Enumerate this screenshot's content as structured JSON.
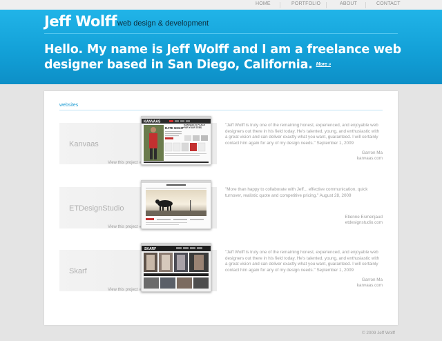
{
  "nav": {
    "items": [
      "HOME",
      "PORTFOLIO",
      "ABOUT",
      "CONTACT"
    ]
  },
  "header": {
    "logo": "Jeff Wolff",
    "tagline": "web design & development",
    "headline": "Hello. My name is Jeff Wolff and I am a freelance web designer based in San Diego, California.",
    "more": "More »"
  },
  "section": {
    "title": "websites"
  },
  "projects": [
    {
      "name": "Kanvaas",
      "link": "View this project »",
      "quote": "\"Jeff Wolff is truly one of the remaining honest, experienced, and enjoyable web designers out there in his field today. He's talented, young, and enthusiastic with a great vision and can deliver exactly what you want, guaranteed. I will certainly contact him again for any of my design needs.\" September 1, 2009",
      "author": "Garron Ma",
      "site": "kanvaas.com",
      "thumb": {
        "brand": "KANVAAS",
        "banner": "DATE NIGHT",
        "side": "KANVAAS IS PLACE FOR YOUR TEES"
      }
    },
    {
      "name": "ETDesignStudio",
      "link": "View this project »",
      "quote": "\"More than happy to collaborate with Jeff... effective communication, quick turnover, realistic quote and competitive pricing.\" August 28, 2009",
      "author": "Etienne Esmenjaud",
      "site": "etdesignstudio.com"
    },
    {
      "name": "Skarf",
      "link": "View this project »",
      "quote": "\"Jeff Wolff is truly one of the remaining honest, experienced, and enjoyable web designers out there in his field today. He's talented, young, and enthusiastic with a great vision and can deliver exactly what you want, guaranteed. I will certainly contact him again for any of my design needs.\" September 1, 2009",
      "author": "Garron Ma",
      "site": "kanvaas.com",
      "thumb": {
        "brand": "SKARF"
      }
    }
  ],
  "footer": {
    "copyright": "© 2009 Jeff Wolff"
  }
}
